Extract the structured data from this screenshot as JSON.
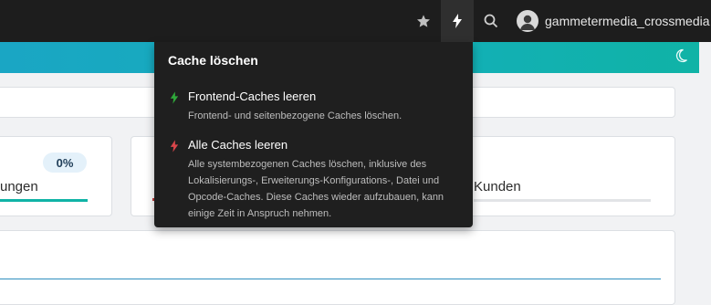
{
  "topbar": {
    "bookmark_icon": "star-icon",
    "cache_icon": "bolt-icon",
    "search_icon": "search-icon",
    "username": "gammetermedia_crossmedia"
  },
  "header": {
    "moon_icon": "moon-icon",
    "accent_color": "#13afb8"
  },
  "dashboard": {
    "left_stat": {
      "badge": "0%",
      "label_fragment": "ungen"
    },
    "right_stat": {
      "label_fragment": "Kunden"
    }
  },
  "cache_menu": {
    "title": "Cache löschen",
    "items": [
      {
        "label": "Frontend-Caches leeren",
        "description": "Frontend- und seitenbezogene Caches löschen.",
        "icon": "bolt-icon",
        "icon_color": "#2fa83a"
      },
      {
        "label": "Alle Caches leeren",
        "description": "Alle systembezogenen Caches löschen, inklusive des Lokalisierungs-, Erweiterungs-Konfigurations-, Datei und Opcode-Caches. Diese Caches wieder aufzubauen, kann einige Zeit in Anspruch nehmen.",
        "icon": "bolt-icon",
        "icon_color": "#d9464a"
      }
    ]
  }
}
